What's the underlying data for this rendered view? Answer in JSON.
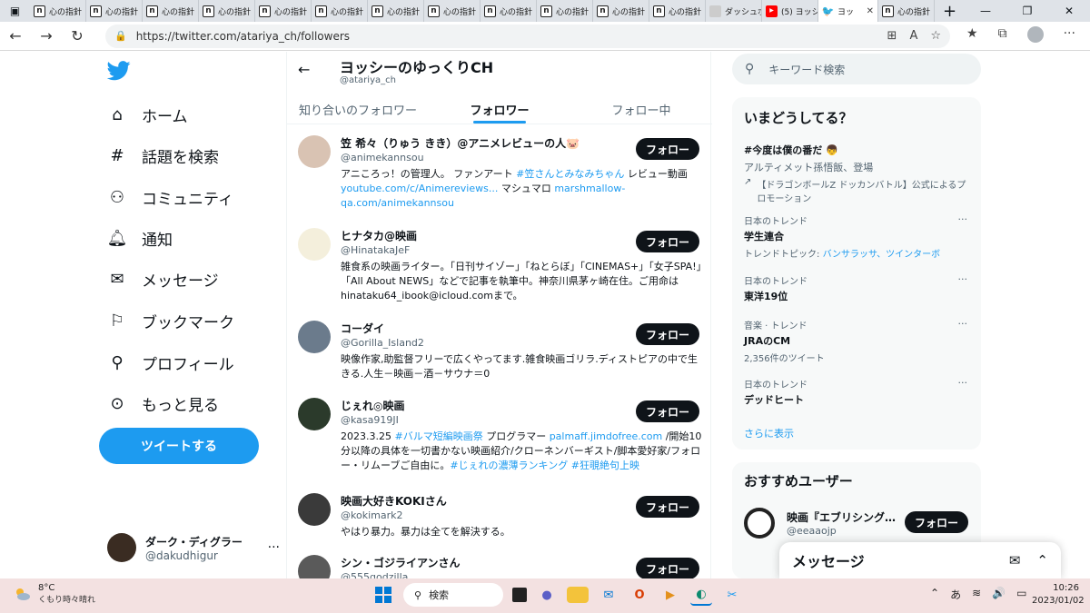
{
  "browser": {
    "tabs": [
      {
        "label": "心の指針"
      },
      {
        "label": "心の指針"
      },
      {
        "label": "心の指針"
      },
      {
        "label": "心の指針"
      },
      {
        "label": "心の指針"
      },
      {
        "label": "心の指針"
      },
      {
        "label": "心の指針"
      },
      {
        "label": "心の指針"
      },
      {
        "label": "心の指針"
      },
      {
        "label": "心の指針"
      },
      {
        "label": "心の指針"
      },
      {
        "label": "心の指針"
      },
      {
        "label": "ダッシュボ"
      },
      {
        "label": "(5) ヨッシ"
      },
      {
        "label": "ヨッ"
      },
      {
        "label": "心の指針"
      }
    ],
    "favicon_letter": "n",
    "url": "https://twitter.com/atariya_ch/followers"
  },
  "sidebar": {
    "items": [
      {
        "label": "ホーム",
        "icon": "home-icon"
      },
      {
        "label": "話題を検索",
        "icon": "hashtag-icon"
      },
      {
        "label": "コミュニティ",
        "icon": "community-icon"
      },
      {
        "label": "通知",
        "icon": "bell-icon"
      },
      {
        "label": "メッセージ",
        "icon": "mail-icon"
      },
      {
        "label": "ブックマーク",
        "icon": "bookmark-icon"
      },
      {
        "label": "プロフィール",
        "icon": "profile-icon"
      },
      {
        "label": "もっと見る",
        "icon": "more-icon"
      }
    ],
    "tweet_button": "ツイートする",
    "me": {
      "name": "ダーク・ディグラー",
      "handle": "@dakudhigur",
      "more": "···"
    }
  },
  "header": {
    "title": "ヨッシーのゆっくりCH",
    "handle": "@atariya_ch"
  },
  "tabs": [
    {
      "label": "知り合いのフォロワー"
    },
    {
      "label": "フォロワー"
    },
    {
      "label": "フォロー中"
    }
  ],
  "follow_label": "フォロー",
  "users": [
    {
      "name": "笠 希々（りゅう きき）@アニメレビューの人🐷",
      "handle": "@animekannsou",
      "bio": [
        {
          "t": "アニころっ！の管理人。 ファンアート "
        },
        {
          "t": "#笠さんとみなみちゃん",
          "link": true
        },
        {
          "t": " レビュー動画 "
        },
        {
          "t": "youtube.com/c/Animereviews...",
          "link": true
        },
        {
          "t": " マシュマロ "
        },
        {
          "t": "marshmallow-qa.com/animekannsou",
          "link": true
        }
      ]
    },
    {
      "name": "ヒナタカ@映画",
      "handle": "@HinatakaJeF",
      "bio": [
        {
          "t": "雑食系の映画ライター。「日刊サイゾー」「ねとらぼ」「CINEMAS+」「女子SPA!」「All About NEWS」などで記事を執筆中。神奈川県茅ヶ崎在住。ご用命はhinataku64_ibook@icloud.comまで。"
        }
      ]
    },
    {
      "name": "コーダイ",
      "handle": "@Gorilla_Island2",
      "bio": [
        {
          "t": "映像作家,助監督フリーで広くやってます.雑食映画ゴリラ.ディストピアの中で生きる.人生－映画－酒－サウナ＝0"
        }
      ]
    },
    {
      "name": "じぇれ◎映画",
      "handle": "@kasa919JI",
      "bio": [
        {
          "t": "2023.3.25 "
        },
        {
          "t": "#バルマ短編映画祭",
          "link": true
        },
        {
          "t": " プログラマー "
        },
        {
          "t": "palmaff.jimdofree.com",
          "link": true
        },
        {
          "t": " /開始10分以降の具体を一切書かない映画紹介/クローネンバーギスト/脚本愛好家/フォロー・リムーブご自由に。"
        },
        {
          "t": "#じぇれの濃薄ランキング",
          "link": true
        },
        {
          "t": " "
        },
        {
          "t": "#狂覗絶句上映",
          "link": true
        }
      ]
    },
    {
      "name": "映画大好きKOKIさん",
      "handle": "@kokimark2",
      "bio": [
        {
          "t": "やはり暴力。暴力は全てを解決する。"
        }
      ]
    },
    {
      "name": "シン・ゴジライアンさん",
      "handle": "@555godzilla",
      "bio": []
    }
  ],
  "right": {
    "search_placeholder": "キーワード検索",
    "trends_title": "いまどうしてる？",
    "trends": [
      {
        "category": "",
        "title": "#今度は僕の番だ 👦",
        "sub": "アルティメット孫悟飯、登場",
        "promo": "【ドラゴンボールZ ドッカンバトル】公式によるプロモーション"
      },
      {
        "category": "日本のトレンド",
        "title": "学生連合",
        "sub_prefix": "トレンドトピック: ",
        "sub_links": "バンサラッサ、ツインターボ"
      },
      {
        "category": "日本のトレンド",
        "title": "東洋19位"
      },
      {
        "category": "音楽 · トレンド",
        "title": "JRAのCM",
        "sub": "2,356件のツイート"
      },
      {
        "category": "日本のトレンド",
        "title": "デッドヒート"
      }
    ],
    "trend_more": "···",
    "show_more": "さらに表示",
    "recommend_title": "おすすめユーザー",
    "recommend": {
      "name": "映画『エブリシング…",
      "handle": "@eeaaojp"
    }
  },
  "messages_panel": {
    "title": "メッセージ"
  },
  "taskbar": {
    "temp": "8°C",
    "weather": "くもり時々晴れ",
    "search": "検索",
    "ime": "あ",
    "time": "10:26",
    "date": "2023/01/02"
  },
  "colors": {
    "accent": "#1d9bf0",
    "dark": "#0f1419",
    "muted": "#536471"
  }
}
